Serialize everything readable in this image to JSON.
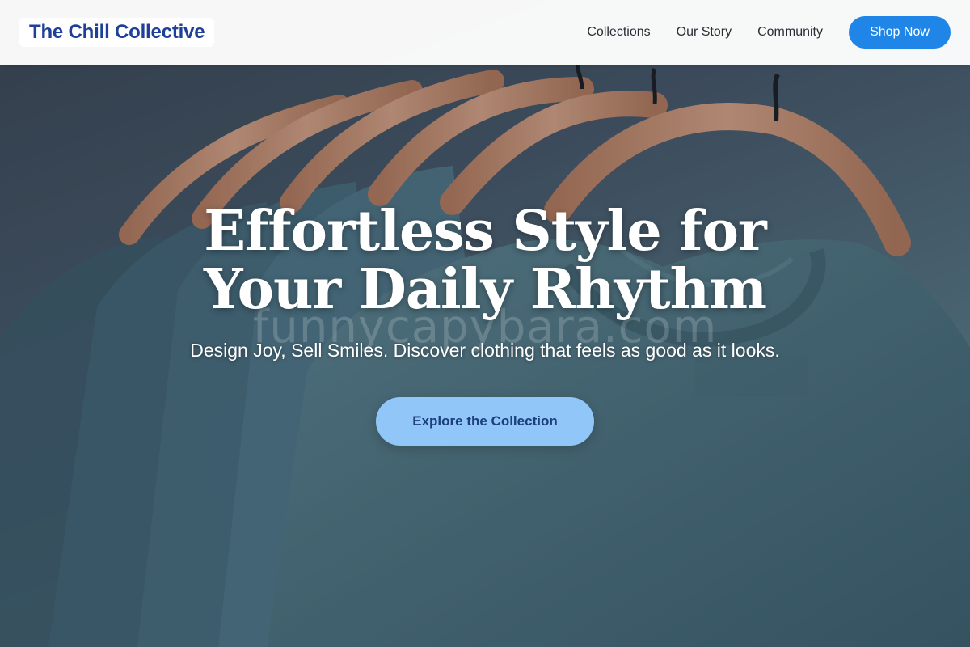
{
  "brand": {
    "name": "The Chill Collective"
  },
  "nav": {
    "links": [
      "Collections",
      "Our Story",
      "Community"
    ],
    "cta_label": "Shop Now"
  },
  "hero": {
    "headline": "Effortless Style for Your Daily Rhythm",
    "subheadline": "Design Joy, Sell Smiles. Discover clothing that feels as good as it looks.",
    "cta_label": "Explore the Collection",
    "watermark": "funnycapybara.com",
    "image": "hero-photo: teal t-shirts on wooden hangers"
  },
  "colors": {
    "brand_text": "#1e3f9a",
    "nav_button": "#1f86e8",
    "hero_button": "#90c6f8",
    "hero_button_text": "#1f3f7a",
    "shirt_teal": "#4f7482",
    "hanger_wood": "#c98f70"
  }
}
